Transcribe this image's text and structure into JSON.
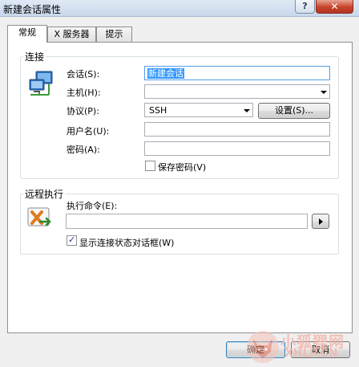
{
  "window": {
    "title": "新建会话属性",
    "help_label": "?",
    "close_label": "✕"
  },
  "tabs": [
    {
      "label": "常规",
      "active": true
    },
    {
      "label": "X 服务器",
      "active": false
    },
    {
      "label": "提示",
      "active": false
    }
  ],
  "connection": {
    "group_title": "连接",
    "icon": "network-computer-icon",
    "session_label": "会话(S):",
    "session_value": "新建会话",
    "host_label": "主机(H):",
    "host_value": "",
    "protocol_label": "协议(P):",
    "protocol_value": "SSH",
    "settings_button": "设置(S)...",
    "username_label": "用户名(U):",
    "username_value": "",
    "password_label": "密码(A):",
    "password_value": "",
    "save_password_label": "保存密码(V)",
    "save_password_checked": false
  },
  "remote_exec": {
    "group_title": "远程执行",
    "icon": "xshell-run-icon",
    "command_label": "执行命令(E):",
    "command_value": "",
    "run_icon": "play-icon",
    "show_dialog_label": "显示连接状态对话框(W)",
    "show_dialog_checked": true
  },
  "footer": {
    "ok_button": "确定",
    "cancel_button": "取消"
  },
  "watermark": {
    "line1": "小狐狸网",
    "line2": "XHLP.CN"
  }
}
